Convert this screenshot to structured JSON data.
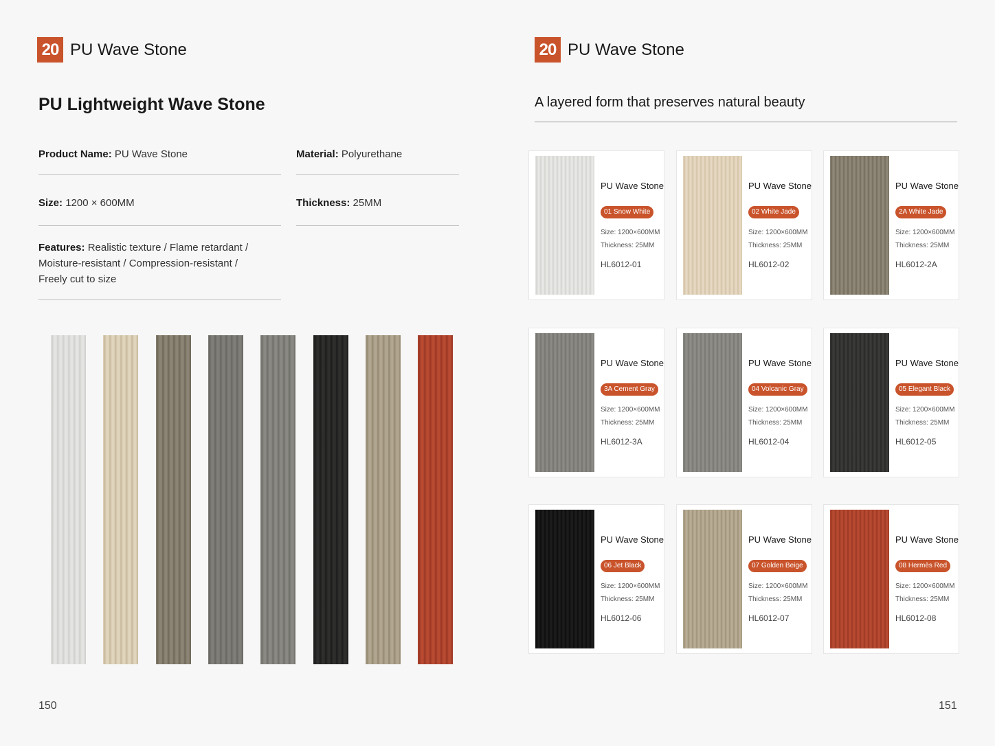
{
  "left_page": {
    "chapter_number": "20",
    "chapter_title": "PU Wave Stone",
    "subtitle": "PU Lightweight Wave Stone",
    "product_name_label": "Product Name:",
    "product_name_value": "PU Wave Stone",
    "material_label": "Material:",
    "material_value": "Polyurethane",
    "size_label": "Size:",
    "size_value": "1200 × 600MM",
    "thickness_label": "Thickness:",
    "thickness_value": "25MM",
    "features_label": "Features:",
    "features_line1": "Realistic texture / Flame retardant /",
    "features_line2": "Moisture-resistant / Compression-resistant /",
    "features_line3": "Freely cut to size",
    "page_number": "150"
  },
  "swatches": [
    {
      "color": "#e4e4e2",
      "shade": "#cfcfcc"
    },
    {
      "color": "#e0d5bd",
      "shade": "#c6b89a"
    },
    {
      "color": "#8c8474",
      "shade": "#6e6656"
    },
    {
      "color": "#7f7e79",
      "shade": "#67665f"
    },
    {
      "color": "#8a8983",
      "shade": "#6f6e68"
    },
    {
      "color": "#2e2f2d",
      "shade": "#1a1b1a"
    },
    {
      "color": "#b1a68f",
      "shade": "#948870"
    },
    {
      "color": "#b84a32",
      "shade": "#983623"
    }
  ],
  "right_page": {
    "chapter_number": "20",
    "chapter_title": "PU Wave Stone",
    "subtitle": "A layered form that preserves natural beauty",
    "page_number": "151",
    "cards": [
      {
        "name": "PU Wave Stone",
        "badge": "01 Snow White",
        "size": "Size: 1200×600MM",
        "thickness": "Thickness:  25MM",
        "code": "HL6012-01",
        "color": "#e8e8e6",
        "shade": "#d2d2cf"
      },
      {
        "name": "PU Wave Stone",
        "badge": "02 White Jade",
        "size": "Size: 1200×600MM",
        "thickness": "Thickness:  25MM",
        "code": "HL6012-02",
        "color": "#e6d8c2",
        "shade": "#d2c2a6"
      },
      {
        "name": "PU Wave Stone",
        "badge": "2A White Jade",
        "size": "Size: 1200×600MM",
        "thickness": "Thickness:  25MM",
        "code": "HL6012-2A",
        "color": "#8f8878",
        "shade": "#736c5c"
      },
      {
        "name": "PU Wave Stone",
        "badge": "3A Cement Gray",
        "size": "Size: 1200×600MM",
        "thickness": "Thickness:  25MM",
        "code": "HL6012-3A",
        "color": "#8c8a84",
        "shade": "#75736d"
      },
      {
        "name": "PU Wave Stone",
        "badge": "04 Volcanic Gray",
        "size": "Size: 1200×600MM",
        "thickness": "Thickness:  25MM",
        "code": "HL6012-04",
        "color": "#8e8d88",
        "shade": "#777671"
      },
      {
        "name": "PU Wave Stone",
        "badge": "05 Elegant Black",
        "size": "Size: 1200×600MM",
        "thickness": "Thickness:  25MM",
        "code": "HL6012-05",
        "color": "#3a3b39",
        "shade": "#262726"
      },
      {
        "name": "PU Wave Stone",
        "badge": "06 Jet Black",
        "size": "Size: 1200×600MM",
        "thickness": "Thickness:  25MM",
        "code": "HL6012-06",
        "color": "#1c1c1c",
        "shade": "#0c0c0c"
      },
      {
        "name": "PU Wave Stone",
        "badge": "07 Golden Beige",
        "size": "Size: 1200×600MM",
        "thickness": "Thickness:  25MM",
        "code": "HL6012-07",
        "color": "#b8ac94",
        "shade": "#9e9279"
      },
      {
        "name": "PU Wave Stone",
        "badge": "08 Hermès Red",
        "size": "Size: 1200×600MM",
        "thickness": "Thickness:  25MM",
        "code": "HL6012-08",
        "color": "#b84a32",
        "shade": "#9a3823"
      }
    ]
  },
  "accent_color": "#c9532b"
}
